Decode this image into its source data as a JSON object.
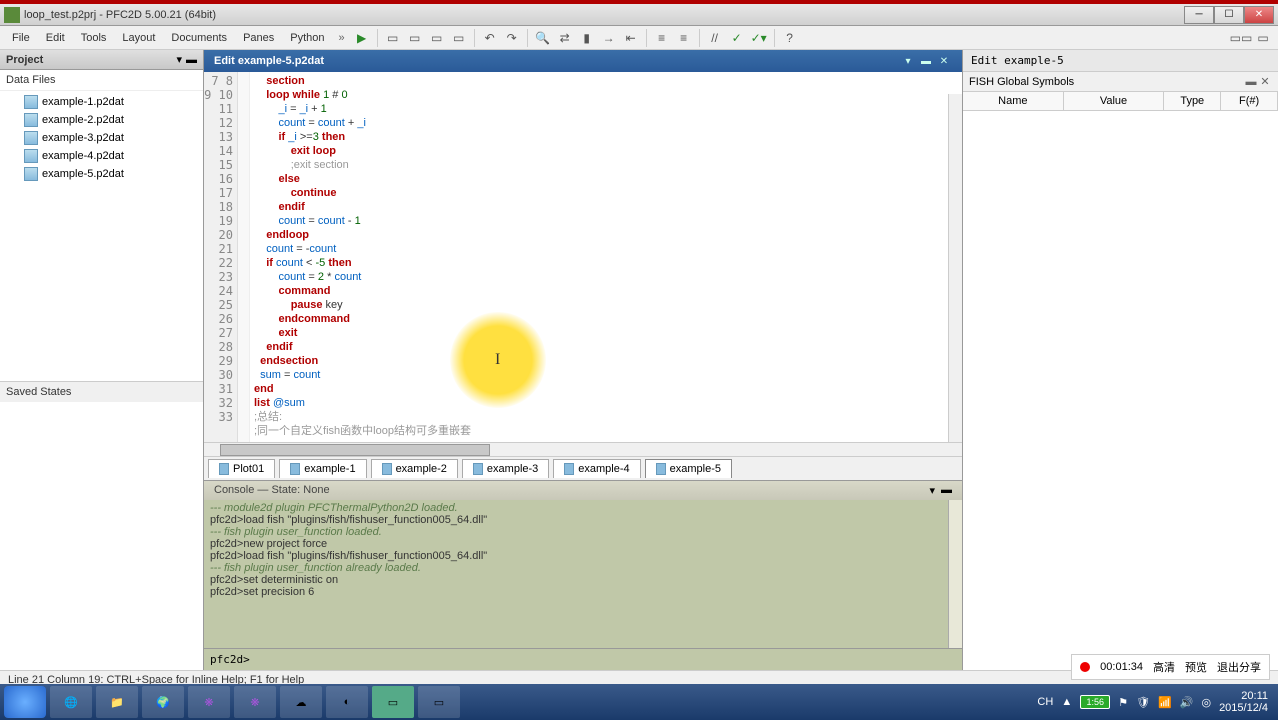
{
  "titlebar": {
    "title": "loop_test.p2prj - PFC2D 5.00.21 (64bit)"
  },
  "menu": {
    "file": "File",
    "edit": "Edit",
    "tools": "Tools",
    "layout": "Layout",
    "documents": "Documents",
    "panes": "Panes",
    "python": "Python"
  },
  "project": {
    "header": "Project",
    "data_files": "Data Files",
    "files": [
      "example-1.p2dat",
      "example-2.p2dat",
      "example-3.p2dat",
      "example-4.p2dat",
      "example-5.p2dat"
    ],
    "saved_states": "Saved States"
  },
  "editor": {
    "title": "Edit example-5.p2dat",
    "lines": [
      {
        "n": 7,
        "t": "section",
        "cls": "kw",
        "ind": 2
      },
      {
        "n": 8,
        "raw": "    <span class='kw'>loop while</span> <span class='num'>1</span> # <span class='num'>0</span>"
      },
      {
        "n": 9,
        "raw": "        <span class='var'>_i</span> = <span class='var'>_i</span> + <span class='num'>1</span>"
      },
      {
        "n": 10,
        "raw": "        <span class='var'>count</span> = <span class='var'>count</span> + <span class='var'>_i</span>"
      },
      {
        "n": 11,
        "raw": "        <span class='kw'>if</span> <span class='var'>_i</span> >=<span class='num'>3</span> <span class='kw'>then</span>"
      },
      {
        "n": 12,
        "raw": "            <span class='kw'>exit loop</span>"
      },
      {
        "n": 13,
        "raw": "            <span class='cmt'>;exit section</span>"
      },
      {
        "n": 14,
        "raw": "        <span class='kw'>else</span>"
      },
      {
        "n": 15,
        "raw": "            <span class='kw'>continue</span>"
      },
      {
        "n": 16,
        "raw": "        <span class='kw'>endif</span>"
      },
      {
        "n": 17,
        "raw": "        <span class='var'>count</span> = <span class='var'>count</span> - <span class='num'>1</span>"
      },
      {
        "n": 18,
        "raw": "    <span class='kw'>endloop</span>"
      },
      {
        "n": 19,
        "raw": "    <span class='var'>count</span> = -<span class='var'>count</span>"
      },
      {
        "n": 20,
        "raw": "    <span class='kw'>if</span> <span class='var'>count</span> &lt; <span class='num'>-5</span> <span class='kw'>then</span>"
      },
      {
        "n": 21,
        "raw": "        <span class='var'>count</span> = <span class='num'>2</span> * <span class='var'>count</span>"
      },
      {
        "n": 22,
        "raw": "        <span class='kw'>command</span>"
      },
      {
        "n": 23,
        "raw": "            <span class='kw'>pause</span> key"
      },
      {
        "n": 24,
        "raw": "        <span class='kw'>endcommand</span>"
      },
      {
        "n": 25,
        "raw": "        <span class='kw'>exit</span>"
      },
      {
        "n": 26,
        "raw": "    <span class='kw'>endif</span>"
      },
      {
        "n": 27,
        "raw": "  <span class='kw'>endsection</span>"
      },
      {
        "n": 28,
        "raw": "  <span class='var'>sum</span> = <span class='var'>count</span>"
      },
      {
        "n": 29,
        "raw": "<span class='kw'>end</span>"
      },
      {
        "n": 30,
        "raw": "<span class='kw'>list</span> <span class='var'>@sum</span>"
      },
      {
        "n": 31,
        "raw": ""
      },
      {
        "n": 32,
        "raw": "<span class='cmt'>;总结:</span>"
      },
      {
        "n": 33,
        "raw": "<span class='cmt'>;同一个自定义fish函数中loop结构可多重嵌套</span>"
      }
    ]
  },
  "tabs": [
    "Plot01",
    "example-1",
    "example-2",
    "example-3",
    "example-4",
    "example-5"
  ],
  "console": {
    "title": "Console — State: None",
    "lines": [
      {
        "c": true,
        "t": "--- module2d plugin PFCThermalPython2D loaded."
      },
      {
        "t": "pfc2d>load fish \"plugins/fish/fishuser_function005_64.dll\""
      },
      {
        "c": true,
        "t": "--- fish plugin user_function loaded."
      },
      {
        "t": "pfc2d>new project force"
      },
      {
        "t": "pfc2d>load fish \"plugins/fish/fishuser_function005_64.dll\""
      },
      {
        "c": true,
        "t": "--- fish plugin user_function already loaded."
      },
      {
        "t": "pfc2d>set deterministic on"
      },
      {
        "t": "pfc2d>set precision 6"
      }
    ],
    "prompt": "pfc2d>"
  },
  "right": {
    "tab": "Edit example-5",
    "title": "FISH Global Symbols",
    "cols": {
      "name": "Name",
      "value": "Value",
      "type": "Type",
      "f": "F(#)"
    }
  },
  "status": "Line 21 Column 19: CTRL+Space for Inline Help; F1 for Help",
  "rec": {
    "time": "00:01:34",
    "hq": "高清",
    "preview": "预览",
    "exit": "退出分享"
  },
  "tray": {
    "ime": "CH",
    "battery": "1:56",
    "time": "20:11",
    "date": "2015/12/4"
  }
}
